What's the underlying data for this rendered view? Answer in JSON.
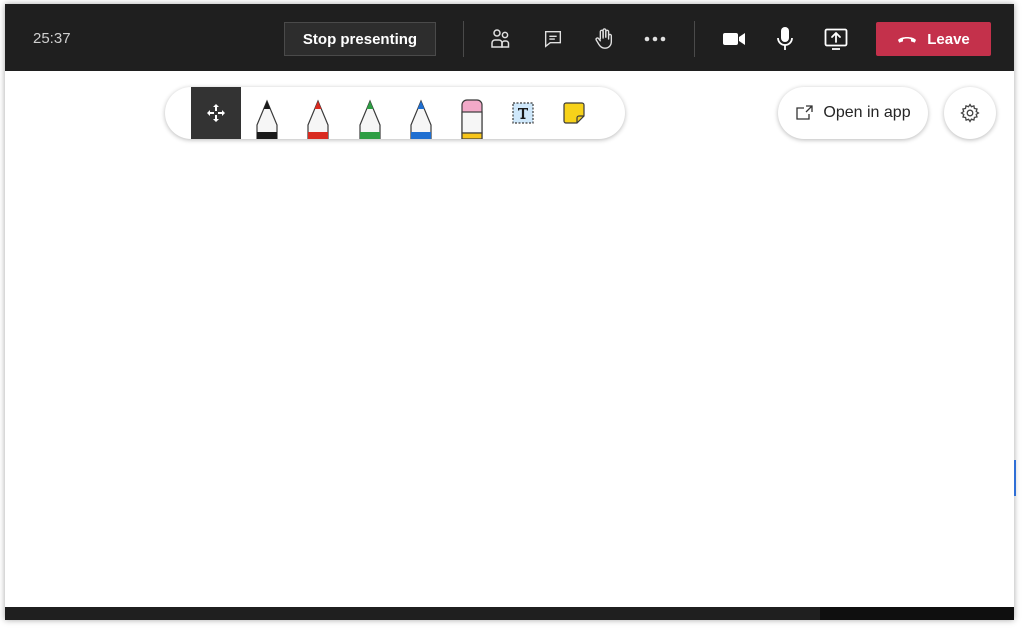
{
  "meeting": {
    "timer": "25:37",
    "stop_presenting_label": "Stop presenting",
    "leave_label": "Leave"
  },
  "toolbar_icons": [
    "people-icon",
    "chat-icon",
    "raise-hand-icon",
    "more-options-icon",
    "camera-icon",
    "microphone-icon",
    "share-screen-icon"
  ],
  "whiteboard": {
    "tools": [
      "move-tool",
      "black-pen",
      "red-pen",
      "green-pen",
      "blue-pen",
      "eraser",
      "text-tool",
      "sticky-note"
    ],
    "pen_colors": {
      "black": "#1a1a1a",
      "red": "#d92b20",
      "green": "#2e9e44",
      "blue": "#1f6fd1"
    },
    "open_in_app_label": "Open in app"
  },
  "colors": {
    "topbar": "#1f1f1f",
    "leave": "#c4314b",
    "sticky": "#f7d21a",
    "eraser_top": "#f2a9c8"
  }
}
